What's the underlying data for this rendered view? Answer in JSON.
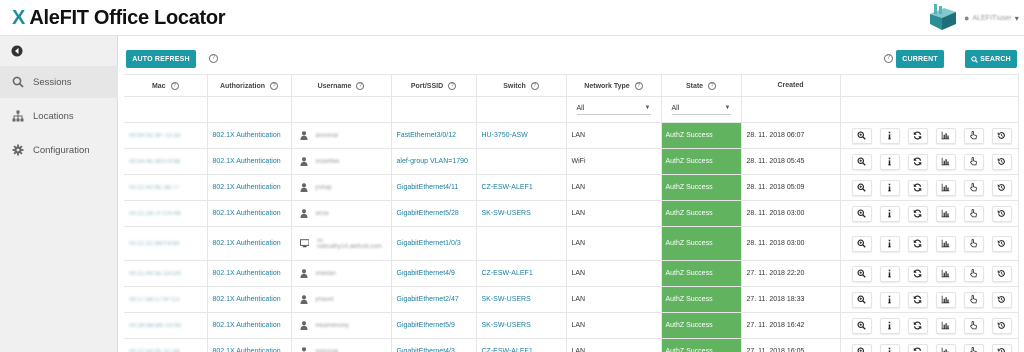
{
  "app": {
    "title": "AleFIT Office Locator",
    "mark": "X",
    "user_label": "ALEFIT\\user"
  },
  "sidebar": {
    "items": [
      {
        "label": "Sessions",
        "icon": "search-icon",
        "active": true
      },
      {
        "label": "Locations",
        "icon": "sitemap-icon",
        "active": false
      },
      {
        "label": "Configuration",
        "icon": "gear-icon",
        "active": false
      }
    ]
  },
  "toolbar": {
    "auto_refresh": "AUTO REFRESH",
    "current": "CURRENT",
    "search": "SEARCH",
    "help": "?"
  },
  "table": {
    "headers": [
      "Mac",
      "Authorization",
      "Username",
      "Port/SSID",
      "Switch",
      "Network Type",
      "State",
      "Created"
    ],
    "filters": {
      "network_type": "All",
      "state": "All"
    },
    "rows": [
      {
        "mac": "00:0A:5C:8F:7D:33",
        "auth": "802.1X Authentication",
        "user": "anovinar",
        "user_icon": "user-icon",
        "port": "FastEthernet3/0/12",
        "switch": "HU-3750-ASW",
        "net": "LAN",
        "state": "AuthZ Success",
        "created": "28. 11. 2018 06:07"
      },
      {
        "mac": "00:0A:4E:B0:F9:9B",
        "auth": "802.1X Authentication",
        "user": "mstefflek",
        "user_icon": "user-icon",
        "port": "alef-group VLAN=1790",
        "switch": "",
        "net": "WiFi",
        "state": "AuthZ Success",
        "created": "28. 11. 2018 05:45"
      },
      {
        "mac": "00:21:A0:9E:3B:77",
        "auth": "802.1X Authentication",
        "user": "jrohajl",
        "user_icon": "user-icon",
        "port": "GigabitEthernet4/11",
        "switch": "CZ-ESW-ALEF1",
        "net": "LAN",
        "state": "AuthZ Success",
        "created": "28. 11. 2018 05:09"
      },
      {
        "mac": "00:21:2B:7F:C4:AB",
        "auth": "802.1X Authentication",
        "user": "drcla",
        "user_icon": "user-icon",
        "port": "GigabitEthernet5/28",
        "switch": "SK-SW-USERS",
        "net": "LAN",
        "state": "AuthZ Success",
        "created": "28. 11. 2018 03:00"
      },
      {
        "mac": "00:21:2C:B6:F8:69",
        "auth": "802.1X Authentication",
        "user": "ss nabcalhy14.alefcob.com",
        "user_icon": "monitor-icon",
        "port": "GigabitEthernet1/0/3",
        "switch": "",
        "net": "LAN",
        "state": "AuthZ Success",
        "created": "28. 11. 2018 03:00"
      },
      {
        "mac": "00:21:A6:5E:D3:D9",
        "auth": "802.1X Authentication",
        "user": "imikitan",
        "user_icon": "user-icon",
        "port": "GigabitEthernet4/9",
        "switch": "CZ-ESW-ALEF1",
        "net": "LAN",
        "state": "AuthZ Success",
        "created": "27. 11. 2018 22:20"
      },
      {
        "mac": "00:17:3B:17:0F:C3",
        "auth": "802.1X Authentication",
        "user": "jrhavnt",
        "user_icon": "user-icon",
        "port": "GigabitEthernet2/47",
        "switch": "SK-SW-USERS",
        "net": "LAN",
        "state": "AuthZ Success",
        "created": "27. 11. 2018 18:33"
      },
      {
        "mac": "00:2B:6B:B6:7D:0D",
        "auth": "802.1X Authentication",
        "user": "mkamenicky",
        "user_icon": "user-icon",
        "port": "GigabitEthernet5/9",
        "switch": "SK-SW-USERS",
        "net": "LAN",
        "state": "AuthZ Success",
        "created": "27. 11. 2018 16:42"
      },
      {
        "mac": "00:21:5A:0E:1C:88",
        "auth": "802.1X Authentication",
        "user": "mdvorak",
        "user_icon": "user-icon",
        "port": "GigabitEthernet4/3",
        "switch": "CZ-ESW-ALEF1",
        "net": "LAN",
        "state": "AuthZ Success",
        "created": "27. 11. 2018 16:05"
      }
    ],
    "actions": [
      "zoom-icon",
      "info-icon",
      "refresh-icon",
      "chart-icon",
      "pointer-icon",
      "history-icon"
    ]
  },
  "colors": {
    "accent": "#1b9aa6",
    "success": "#62b35f",
    "link": "#1e7f9e"
  }
}
